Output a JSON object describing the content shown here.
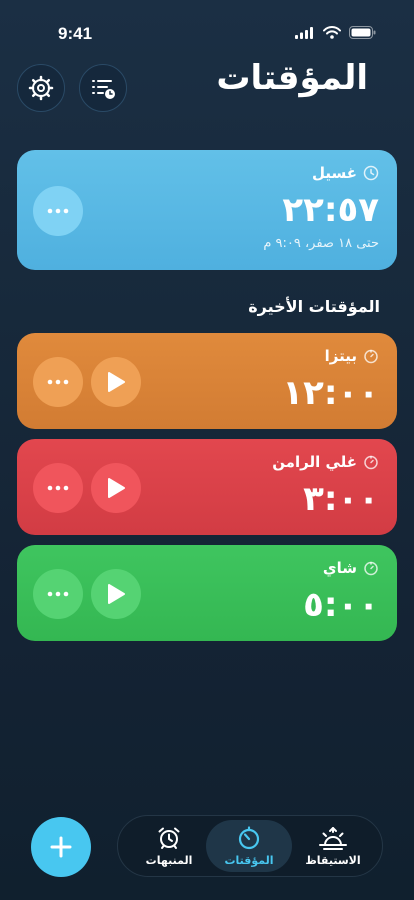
{
  "status_bar": {
    "time": "9:41"
  },
  "header": {
    "title": "المؤقتات",
    "settings_icon": "gear-icon",
    "list_icon": "list-clock-icon"
  },
  "active_timer": {
    "label": "غسيل",
    "time": "٢٢:٥٧",
    "until": "حتى ١٨ صفر، ٩:٠٩ م",
    "color": "#5ab8e4"
  },
  "recent": {
    "title": "المؤقتات الأخيرة",
    "timers": [
      {
        "label": "بيتزا",
        "time": "١٢:٠٠",
        "color": "#d9833a"
      },
      {
        "label": "غلي الرامن",
        "time": "٣:٠٠",
        "color": "#dc424a"
      },
      {
        "label": "شاي",
        "time": "٥:٠٠",
        "color": "#3abf59"
      }
    ]
  },
  "tabs": [
    {
      "label": "المنبهات",
      "icon": "alarm-clock-icon",
      "active": false
    },
    {
      "label": "المؤقتات",
      "icon": "timer-icon",
      "active": true
    },
    {
      "label": "الاستيقاظ",
      "icon": "sunrise-icon",
      "active": false
    }
  ],
  "accent": "#48c7f0"
}
